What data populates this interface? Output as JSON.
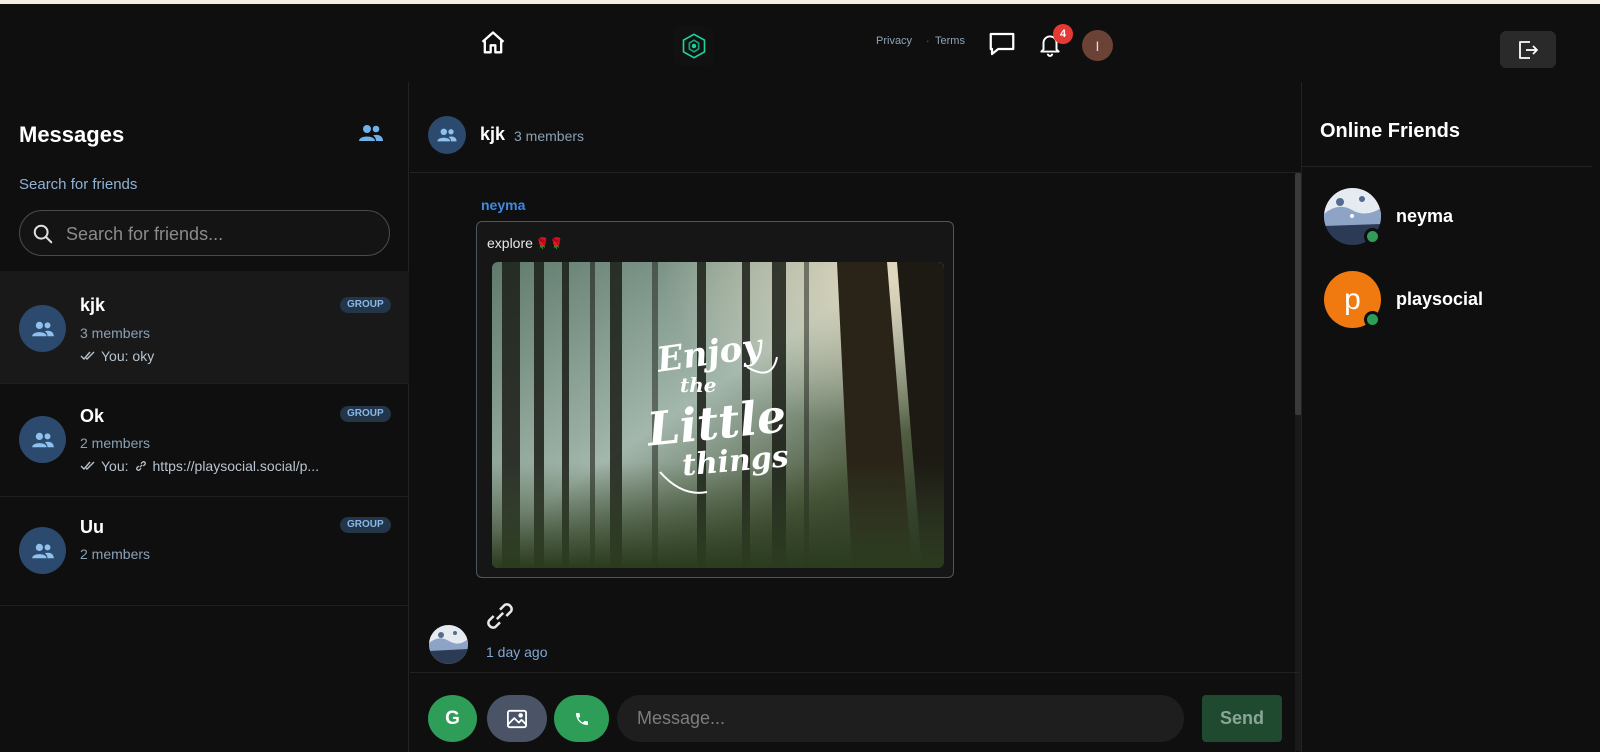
{
  "topbar": {
    "privacy": "Privacy",
    "separator": "·",
    "terms": "Terms",
    "notification_count": "4",
    "user_initial": "I"
  },
  "sidebar": {
    "title": "Messages",
    "search_label": "Search for friends",
    "search_placeholder": "Search for friends...",
    "conversations": [
      {
        "name": "kjk",
        "tag": "GROUP",
        "members": "3 members",
        "last_prefix": "You: oky",
        "last_link": "",
        "active": true
      },
      {
        "name": "Ok",
        "tag": "GROUP",
        "members": "2 members",
        "last_prefix": "You:",
        "last_link": "https://playsocial.social/p...",
        "active": false
      },
      {
        "name": "Uu",
        "tag": "GROUP",
        "members": "2 members",
        "last_prefix": "",
        "last_link": "",
        "active": false
      }
    ]
  },
  "chat": {
    "name": "kjk",
    "members": "3 members",
    "message": {
      "sender": "neyma",
      "text": "explore",
      "emoji": "🌹🌹",
      "image_text_1": "Enjoy",
      "image_text_2": "the",
      "image_text_3": "Little",
      "image_text_4": "things",
      "time": "1 day ago"
    },
    "composer": {
      "gif_label": "G",
      "placeholder": "Message...",
      "send_label": "Send"
    }
  },
  "online": {
    "title": "Online Friends",
    "friends": [
      {
        "name": "neyma",
        "initial": ""
      },
      {
        "name": "playsocial",
        "initial": "p"
      }
    ]
  },
  "colors": {
    "background": "#0f0f0f",
    "accent_green": "#2e9d57",
    "accent_blue": "#3f8ae0",
    "badge_red": "#e53935",
    "avatar_blue": "#2c4a6e",
    "avatar_orange": "#f07a10"
  },
  "icons": [
    "home-icon",
    "logo-icon",
    "chat-icon",
    "bell-icon",
    "logout-icon",
    "friends-icon",
    "search-icon",
    "group-icon",
    "double-check-icon",
    "link-icon",
    "paperclip-icon",
    "image-icon",
    "phone-icon"
  ]
}
